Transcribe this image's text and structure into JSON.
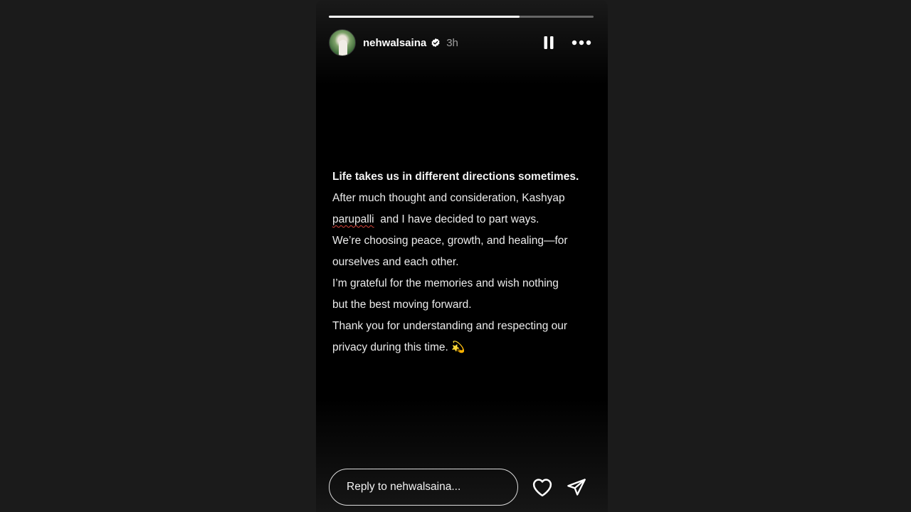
{
  "story": {
    "progress_fraction": 0.72,
    "username": "nehwalsaina",
    "verified": true,
    "time_ago": "3h",
    "icons": {
      "avatar": "profile-photo",
      "verified": "verified-badge-icon",
      "pause": "pause-icon",
      "more": "more-options-icon",
      "like": "heart-icon",
      "share": "send-paper-plane-icon"
    },
    "colors": {
      "page_bg": "#1b1b1b",
      "story_bg": "#000000",
      "text": "#ececec",
      "spellcheck_underline": "#d6433a"
    }
  },
  "caption": {
    "title": "Life takes us in different directions sometimes.",
    "line1": "After much thought and consideration, Kashyap",
    "line2_word": "parupalli",
    "line2_rest": "  and I have decided to part ways.",
    "line3": "We’re choosing peace, growth, and healing—for",
    "line4": "ourselves and each other.",
    "line5": "I’m grateful for the memories and wish nothing",
    "line6": "but the best moving forward.",
    "line7": "Thank you for understanding and respecting our",
    "line8_text": "privacy during this time.",
    "line8_emoji": "💫"
  },
  "reply": {
    "placeholder": "Reply to nehwalsaina..."
  }
}
